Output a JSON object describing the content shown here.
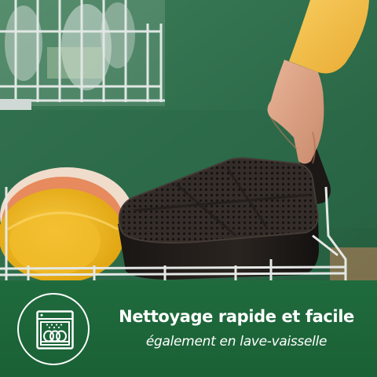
{
  "banner": {
    "headline": "Nettoyage rapide et facile",
    "subline": "également en lave-vaisselle",
    "color": "#1f6b3d"
  },
  "badge": {
    "icon": "dishwasher-icon"
  },
  "photo": {
    "wall_color": "#2f6e4c",
    "sleeve_color": "#f2bd4a",
    "basket_color": "#2b2522",
    "plate_color": "#f1b81c"
  }
}
